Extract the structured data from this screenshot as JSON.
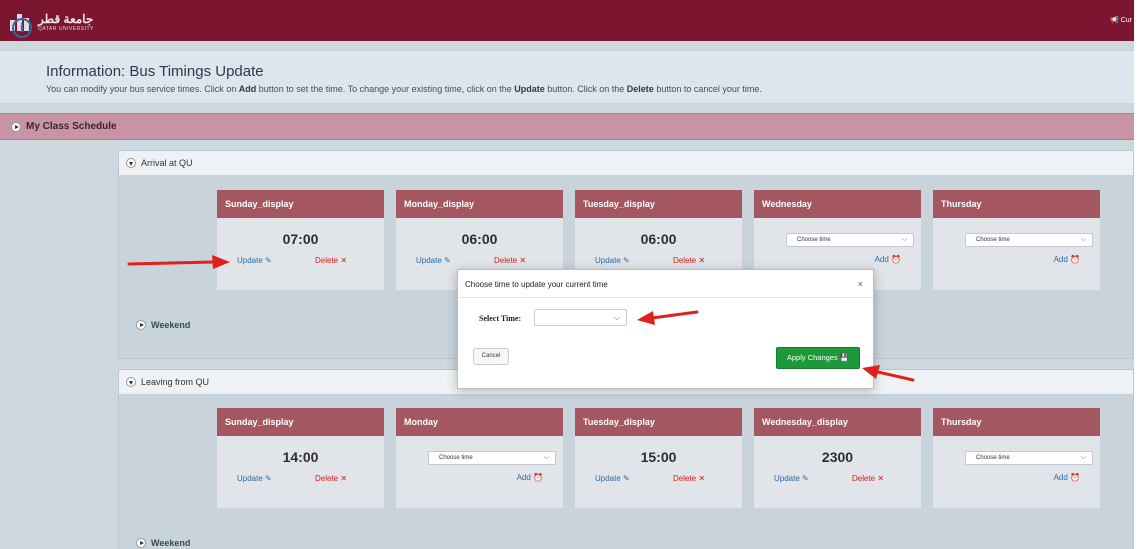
{
  "header": {
    "logo_arabic": "جامعة قطر",
    "logo_english": "QATAR UNIVERSITY",
    "right_text": "Cur"
  },
  "info": {
    "title": "Information: Bus Timings Update",
    "text_1": "You can modify your bus service times. Click on ",
    "add_word": "Add",
    "text_2": " button to set the time. To change your existing time, click on the ",
    "update_word": "Update",
    "text_3": " button. Click on the ",
    "delete_word": "Delete",
    "text_4": " button to cancel your time."
  },
  "schedule_bar": {
    "label": "My Class Schedule"
  },
  "arrival": {
    "title": "Arrival at QU",
    "weekend_label": "Weekend",
    "cards": [
      {
        "day": "Sunday_display",
        "time": "07:00",
        "update": "Update",
        "delete": "Delete"
      },
      {
        "day": "Monday_display",
        "time": "06:00",
        "update": "Update",
        "delete": "Delete"
      },
      {
        "day": "Tuesday_display",
        "time": "06:00",
        "update": "Update",
        "delete": "Delete"
      },
      {
        "day": "Wednesday",
        "select": "Choose time",
        "add": "Add"
      },
      {
        "day": "Thursday",
        "select": "Choose time",
        "add": "Add"
      }
    ]
  },
  "leaving": {
    "title": "Leaving from QU",
    "weekend_label": "Weekend",
    "cards": [
      {
        "day": "Sunday_display",
        "time": "14:00",
        "update": "Update",
        "delete": "Delete"
      },
      {
        "day": "Monday",
        "select": "Choose time",
        "add": "Add"
      },
      {
        "day": "Tuesday_display",
        "time": "15:00",
        "update": "Update",
        "delete": "Delete"
      },
      {
        "day": "Wednesday_display",
        "time": "2300",
        "update": "Update",
        "delete": "Delete"
      },
      {
        "day": "Thursday",
        "select": "Choose time",
        "add": "Add"
      }
    ]
  },
  "modal": {
    "title": "Choose time to update your current time",
    "close": "×",
    "select_label": "Select Time:",
    "select_value": "",
    "cancel_label": "Cancel",
    "apply_label": "Apply Changes"
  },
  "glyphs": {
    "delete_x": "✕",
    "chevron": "⌵"
  },
  "colors": {
    "topbar": "#7b1530",
    "card_header": "#a45661",
    "apply": "#1c9a3a",
    "arrow": "#e0201a"
  }
}
